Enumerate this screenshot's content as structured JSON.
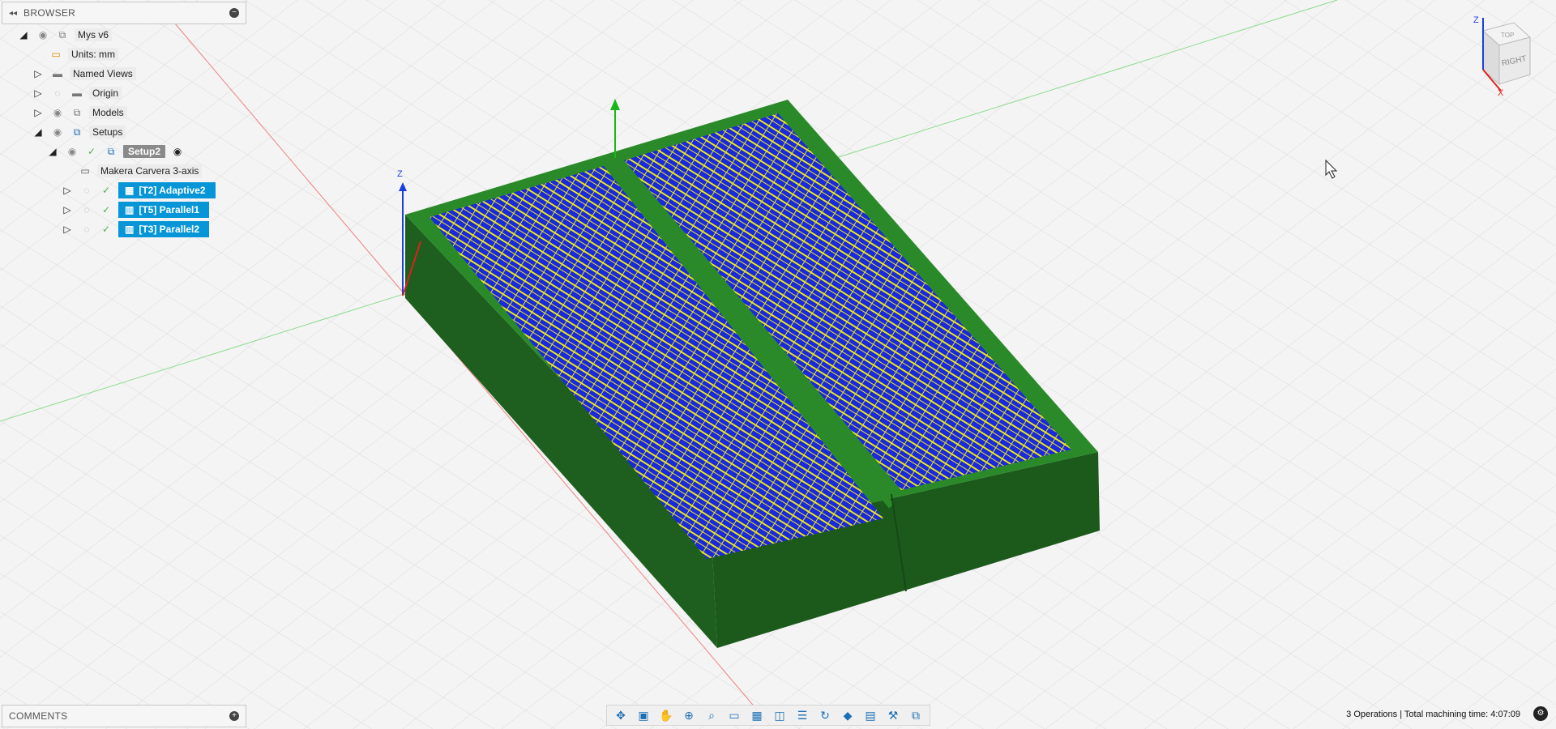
{
  "browser": {
    "title": "BROWSER",
    "root": "Mys v6",
    "units": "Units: mm",
    "named_views": "Named Views",
    "origin": "Origin",
    "models": "Models",
    "setups": "Setups",
    "setup": "Setup2",
    "machine": "Makera Carvera 3-axis",
    "operations": [
      {
        "label": "[T2] Adaptive2"
      },
      {
        "label": "[T5] Parallel1"
      },
      {
        "label": "[T3] Parallel2"
      }
    ]
  },
  "comments": {
    "title": "COMMENTS"
  },
  "viewcube": {
    "face_right": "RIGHT",
    "face_top": "TOP",
    "axis_z": "Z",
    "axis_x": "X"
  },
  "triad": {
    "axis_z": "Z"
  },
  "status": {
    "text": "3 Operations | Total machining time: 4:07:09"
  },
  "toolbar": {
    "icons": [
      "orbit-icon",
      "look-at-icon",
      "pan-icon",
      "zoom-icon",
      "zoom-window-icon",
      "display-settings-icon",
      "grid-icon",
      "viewports-icon",
      "layout-icon",
      "refresh-icon",
      "section-icon",
      "environment-icon",
      "tool-icon",
      "stock-icon"
    ]
  },
  "colors": {
    "stock": "#1f6b1f",
    "stock_top": "#2a8a2a",
    "pocket": "#1a28e0",
    "toolpath": "#f5f500",
    "selected": "#0696d7"
  }
}
